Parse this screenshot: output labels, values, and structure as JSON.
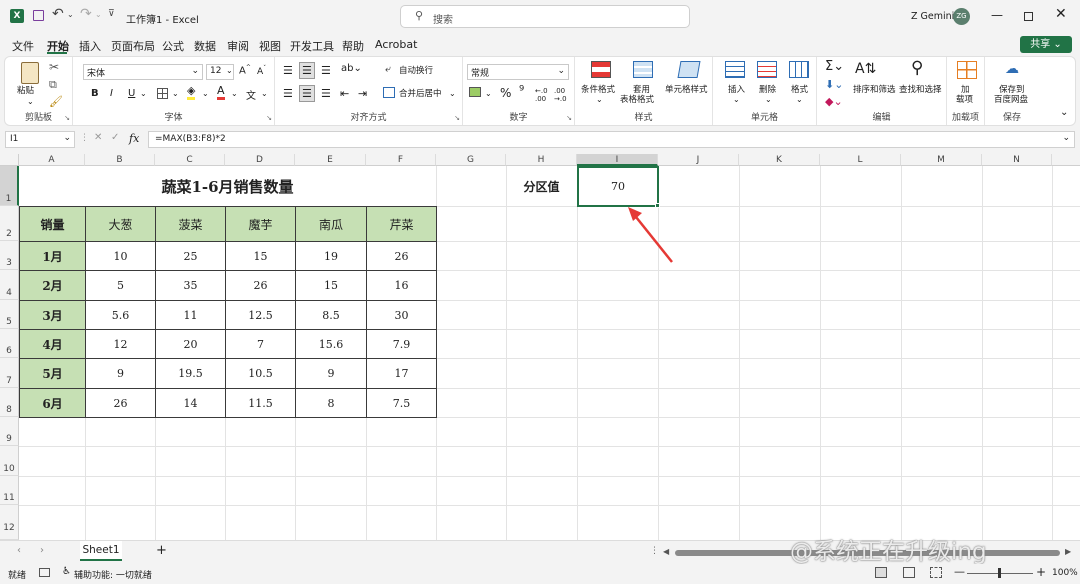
{
  "app": {
    "title": "工作簿1 - Excel",
    "search_placeholder": "搜索",
    "user": "Z Gemini",
    "avatar": "ZG",
    "share": "共享"
  },
  "menu": [
    "文件",
    "开始",
    "插入",
    "页面布局",
    "公式",
    "数据",
    "审阅",
    "视图",
    "开发工具",
    "帮助",
    "Acrobat"
  ],
  "ribbon": {
    "paste": "粘贴",
    "clipboard": "剪贴板",
    "font_name": "宋体",
    "font_size": "12",
    "font_group": "字体",
    "wrap": "自动换行",
    "merge": "合并后居中",
    "align_group": "对齐方式",
    "num_format": "常规",
    "number_group": "数字",
    "cond_format": "条件格式",
    "table_fmt1": "套用",
    "table_fmt2": "表格格式",
    "cell_style": "单元格样式",
    "style_group": "样式",
    "insert": "插入",
    "delete": "删除",
    "format": "格式",
    "cells_group": "单元格",
    "sort": "排序和筛选",
    "find": "查找和选择",
    "edit_group": "编辑",
    "addin1": "加",
    "addin2": "载项",
    "addin_group": "加载项",
    "save1": "保存到",
    "save2": "百度网盘",
    "save_group": "保存",
    "bold": "B",
    "italic": "I",
    "underline": "U",
    "font_color": "A"
  },
  "formula_bar": {
    "name_box": "I1",
    "fx": "fx",
    "formula": "=MAX(B3:F8)*2"
  },
  "columns": [
    "A",
    "B",
    "C",
    "D",
    "E",
    "F",
    "G",
    "H",
    "I",
    "J",
    "K",
    "L",
    "M",
    "N"
  ],
  "rows": [
    "1",
    "2",
    "3",
    "4",
    "5",
    "6",
    "7",
    "8",
    "9",
    "10",
    "11",
    "12"
  ],
  "sheet": {
    "title": "蔬菜1-6月销售数量",
    "headers": [
      "销量",
      "大葱",
      "菠菜",
      "魔芋",
      "南瓜",
      "芹菜"
    ],
    "data": [
      [
        "1月",
        "10",
        "25",
        "15",
        "19",
        "26"
      ],
      [
        "2月",
        "5",
        "35",
        "26",
        "15",
        "16"
      ],
      [
        "3月",
        "5.6",
        "11",
        "12.5",
        "8.5",
        "30"
      ],
      [
        "4月",
        "12",
        "20",
        "7",
        "15.6",
        "7.9"
      ],
      [
        "5月",
        "9",
        "19.5",
        "10.5",
        "9",
        "17"
      ],
      [
        "6月",
        "26",
        "14",
        "11.5",
        "8",
        "7.5"
      ]
    ],
    "label": "分区值",
    "value": "70"
  },
  "tabs": {
    "sheet1": "Sheet1",
    "add": "+"
  },
  "status": {
    "ready": "就绪",
    "accessibility": "辅助功能: 一切就绪",
    "zoom": "100%"
  },
  "watermark": "@系统正在升级ing",
  "colors": {
    "accent": "#217346",
    "header_fill": "#c6e0b4",
    "arrow": "#e53935"
  }
}
